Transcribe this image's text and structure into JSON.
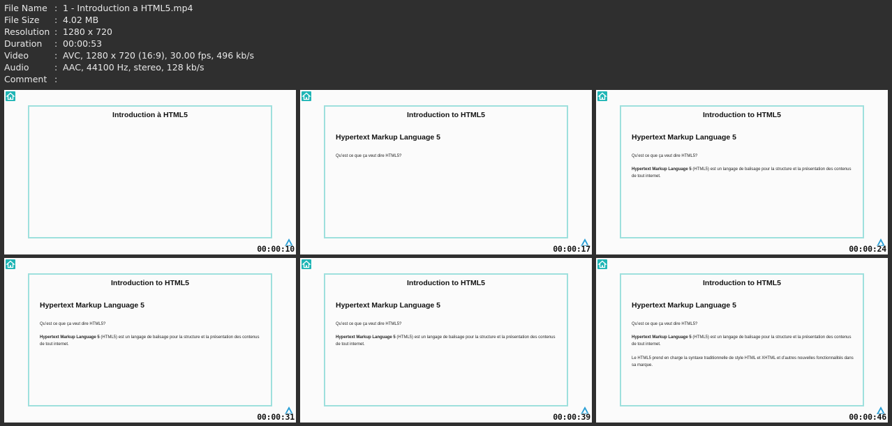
{
  "meta": {
    "file_name_label": "File Name",
    "file_name": "1 - Introduction a HTML5.mp4",
    "file_size_label": "File Size",
    "file_size": "4.02 MB",
    "resolution_label": "Resolution",
    "resolution": "1280 x 720",
    "duration_label": "Duration",
    "duration": "00:00:53",
    "video_label": "Video",
    "video": "AVC, 1280 x 720 (16:9), 30.00 fps, 496 kb/s",
    "audio_label": "Audio",
    "audio": "AAC, 44100 Hz, stereo, 128 kb/s",
    "comment_label": "Comment",
    "comment": "",
    "colon": ":"
  },
  "slides": {
    "title_fr": "Introduction à HTML5",
    "title_en": "Introduction to HTML5",
    "subtitle": "Hypertext Markup Language 5",
    "question": "Qu’est ce que ça veut dire HTML5?",
    "p1_bold": "Hypertext Markup Language 5",
    "p1_rest": " (HTML5) est un langage de balisage pour la structure et la présentation des contenus de tout internet.",
    "p2": "Le HTML5 prend en charge la syntaxe traditionnelle de style HTML et XHTML et d’autres nouvelles fonctionnalités dans sa marque."
  },
  "thumbs": [
    {
      "time": "00:00:10"
    },
    {
      "time": "00:00:17"
    },
    {
      "time": "00:00:24"
    },
    {
      "time": "00:00:31"
    },
    {
      "time": "00:00:39"
    },
    {
      "time": "00:00:46"
    }
  ],
  "colors": {
    "background": "#2f2f2f",
    "slide_bg": "#fbfbfb",
    "frame_border": "#9ee0dd",
    "icon_teal": "#1fb5b5"
  },
  "icons": {
    "home": "home-icon",
    "logo": "triangle-logo-icon"
  }
}
